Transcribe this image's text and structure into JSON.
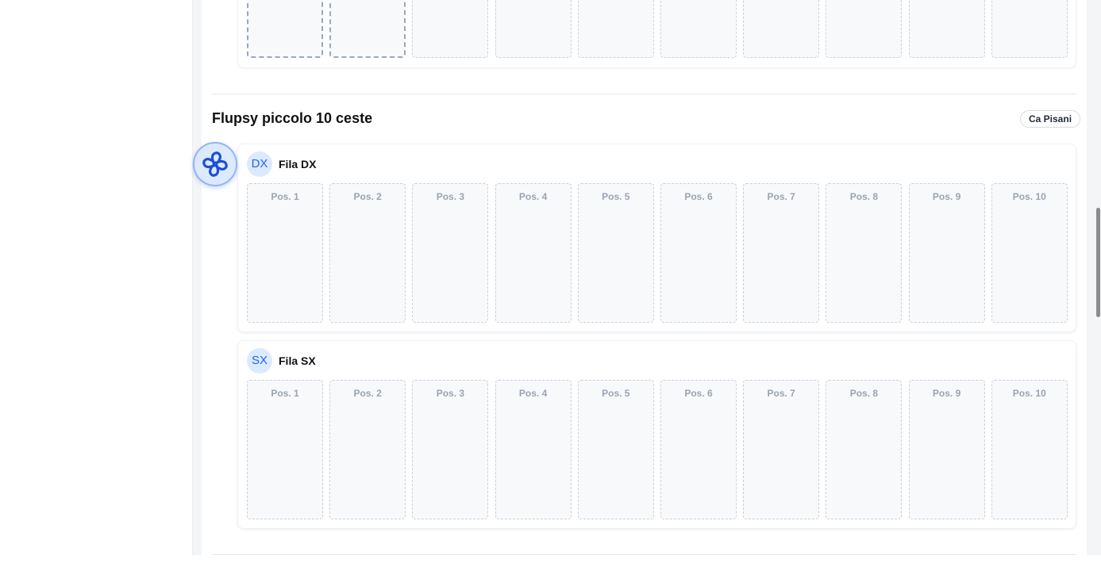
{
  "previous_flupsy": {
    "positions": [
      "",
      "",
      "",
      "",
      "",
      "",
      "",
      "",
      "",
      ""
    ]
  },
  "flupsy": {
    "title": "Flupsy piccolo 10 ceste",
    "location": "Ca Pisani",
    "rows": [
      {
        "badge": "DX",
        "name": "Fila DX",
        "positions": [
          "Pos. 1",
          "Pos. 2",
          "Pos. 3",
          "Pos. 4",
          "Pos. 5",
          "Pos. 6",
          "Pos. 7",
          "Pos. 8",
          "Pos. 9",
          "Pos. 10"
        ]
      },
      {
        "badge": "SX",
        "name": "Fila SX",
        "positions": [
          "Pos. 1",
          "Pos. 2",
          "Pos. 3",
          "Pos. 4",
          "Pos. 5",
          "Pos. 6",
          "Pos. 7",
          "Pos. 8",
          "Pos. 9",
          "Pos. 10"
        ]
      }
    ]
  },
  "fan_button": {
    "icon": "fan-icon"
  },
  "colors": {
    "accent": "#2563eb",
    "badge_bg": "#dbeafe",
    "basket_border": "#c9d1dc",
    "basket_bg": "#f8f9fb",
    "pos_label": "#9aa4b2"
  }
}
